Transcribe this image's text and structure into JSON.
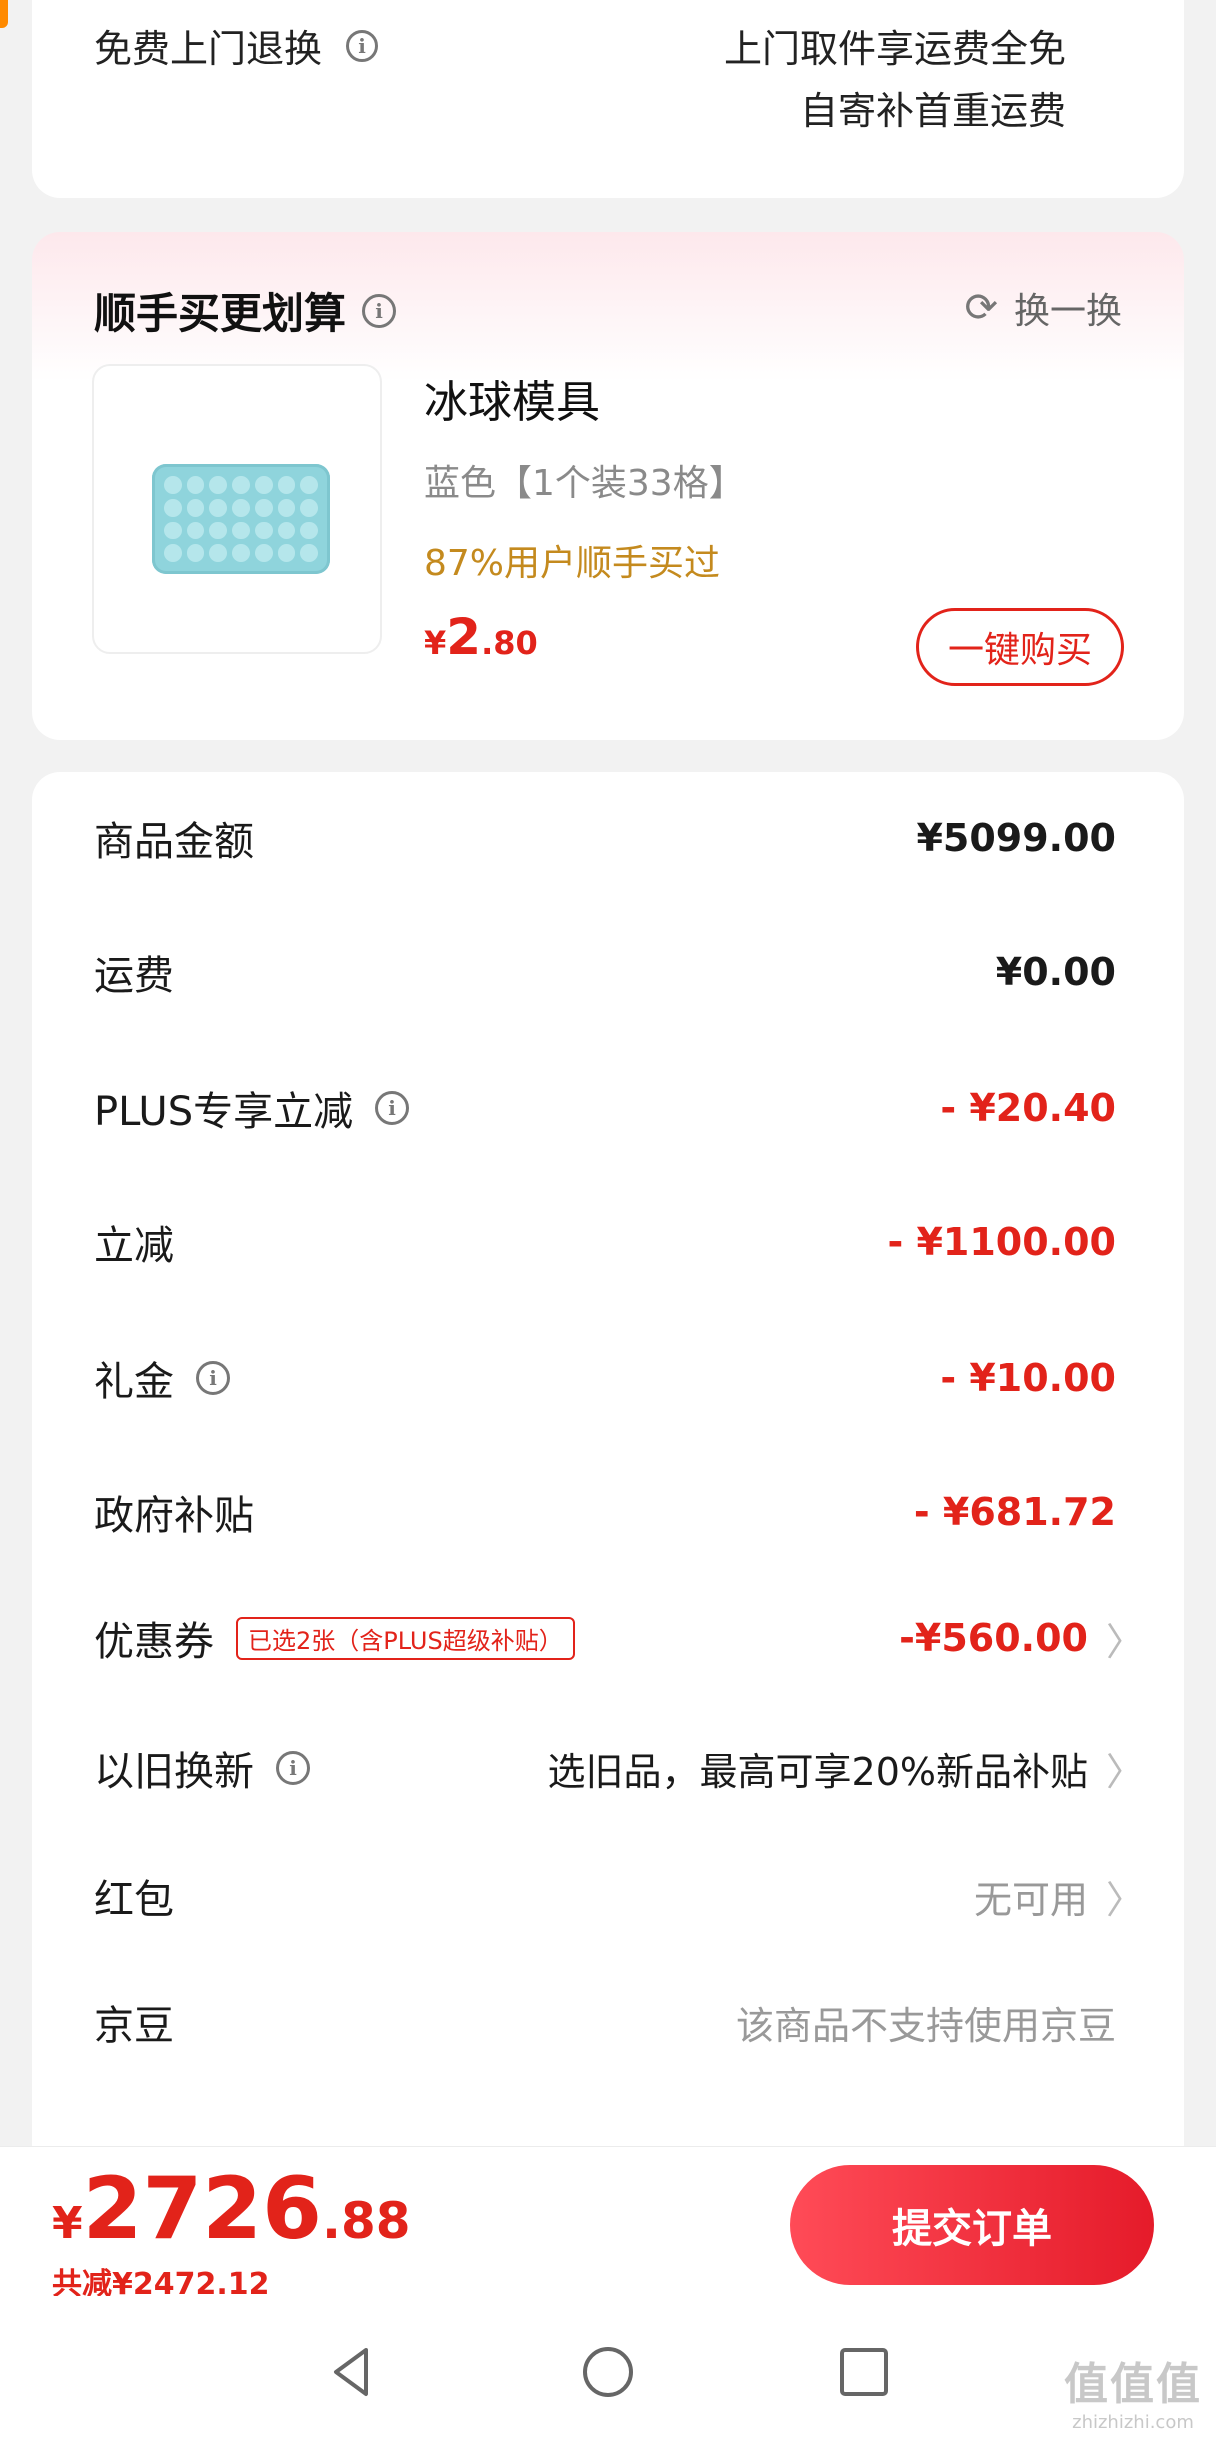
{
  "service": {
    "label": "免费上门退换",
    "line1": "上门取件享运费全免",
    "line2": "自寄补首重运费"
  },
  "addon": {
    "title": "顺手买更划算",
    "swap_label": "换一换",
    "product": {
      "name": "冰球模具",
      "spec": "蓝色【1个装33格】",
      "buyers": "87%用户顺手买过",
      "price_symbol": "¥",
      "price_int": "2",
      "price_dec": ".80",
      "buy_label": "一键购买"
    }
  },
  "summary": {
    "rows": [
      {
        "label": "商品金额",
        "value": "¥5099.00"
      },
      {
        "label": "运费",
        "value": "¥0.00"
      },
      {
        "label": "PLUS专享立减",
        "value": "- ¥20.40"
      },
      {
        "label": "立减",
        "value": "- ¥1100.00"
      },
      {
        "label": "礼金",
        "value": "- ¥10.00"
      },
      {
        "label": "政府补贴",
        "value": "- ¥681.72"
      },
      {
        "label": "优惠券",
        "tag": "已选2张（含PLUS超级补贴）",
        "value": "-¥560.00"
      },
      {
        "label": "以旧换新",
        "value": "选旧品，最高可享20%新品补贴"
      },
      {
        "label": "红包",
        "value": "无可用"
      },
      {
        "label": "京豆",
        "value": "该商品不支持使用京豆"
      }
    ]
  },
  "checkout": {
    "symbol": "¥",
    "total_int": "2726",
    "total_dec": ".88",
    "saved": "共减¥2472.12",
    "submit_label": "提交订单"
  },
  "watermark": {
    "top": "值值值",
    "bottom": "zhizhizhi.com"
  },
  "icons": {
    "info": "info-circle-icon",
    "swap": "refresh-icon",
    "chevron": "chevron-right-icon",
    "nav_back": "triangle-back-icon",
    "nav_home": "circle-home-icon",
    "nav_recent": "square-recent-icon"
  },
  "colors": {
    "accent": "#e2231a",
    "buyers_text": "#c48a1e",
    "submit_gradient_start": "#ff4b57",
    "submit_gradient_end": "#e51b2a"
  }
}
